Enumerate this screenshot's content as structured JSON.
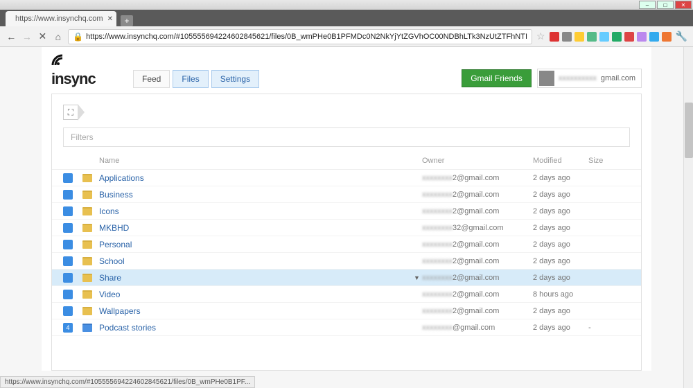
{
  "window": {
    "tab_title": "https://www.insynchq.com",
    "url_display": "https://www.insynchq.com/#105555694224602845621/files/0B_wmPHe0B1PFMDc0N2NkYjYtZGVhOC00NDBhLTk3NzUtZTFhNTI"
  },
  "app": {
    "logo_text": "insync",
    "tabs": {
      "feed": "Feed",
      "files": "Files",
      "settings": "Settings"
    },
    "gmail_btn": "Gmail Friends",
    "user_email": "gmail.com"
  },
  "filters_placeholder": "Filters",
  "columns": {
    "name": "Name",
    "owner": "Owner",
    "modified": "Modified",
    "size": "Size"
  },
  "breadcrumb_icon": "⛶",
  "rows": [
    {
      "count": "",
      "name": "Applications",
      "owner": "2@gmail.com",
      "modified": "2 days ago",
      "size": "",
      "type": "folder",
      "selected": false
    },
    {
      "count": "",
      "name": "Business",
      "owner": "2@gmail.com",
      "modified": "2 days ago",
      "size": "",
      "type": "folder",
      "selected": false
    },
    {
      "count": "",
      "name": "Icons",
      "owner": "2@gmail.com",
      "modified": "2 days ago",
      "size": "",
      "type": "folder",
      "selected": false
    },
    {
      "count": "",
      "name": "MKBHD",
      "owner": "32@gmail.com",
      "modified": "2 days ago",
      "size": "",
      "type": "folder",
      "selected": false
    },
    {
      "count": "",
      "name": "Personal",
      "owner": "2@gmail.com",
      "modified": "2 days ago",
      "size": "",
      "type": "folder",
      "selected": false
    },
    {
      "count": "",
      "name": "School",
      "owner": "2@gmail.com",
      "modified": "2 days ago",
      "size": "",
      "type": "folder",
      "selected": false
    },
    {
      "count": "",
      "name": "Share",
      "owner": "2@gmail.com",
      "modified": "2 days ago",
      "size": "",
      "type": "folder",
      "selected": true
    },
    {
      "count": "",
      "name": "Video",
      "owner": "2@gmail.com",
      "modified": "8 hours ago",
      "size": "",
      "type": "folder",
      "selected": false
    },
    {
      "count": "",
      "name": "Wallpapers",
      "owner": "2@gmail.com",
      "modified": "2 days ago",
      "size": "",
      "type": "folder",
      "selected": false
    },
    {
      "count": "4",
      "name": "Podcast stories",
      "owner": "@gmail.com",
      "modified": "2 days ago",
      "size": "-",
      "type": "doc",
      "selected": false
    }
  ],
  "statusbar": "https://www.insynchq.com/#105555694224602845621/files/0B_wmPHe0B1PF...",
  "ext_colors": [
    "#d33",
    "#888",
    "#fc3",
    "#5b8",
    "#6cf",
    "#2a6",
    "#d44",
    "#b8e",
    "#3ae",
    "#e73"
  ]
}
